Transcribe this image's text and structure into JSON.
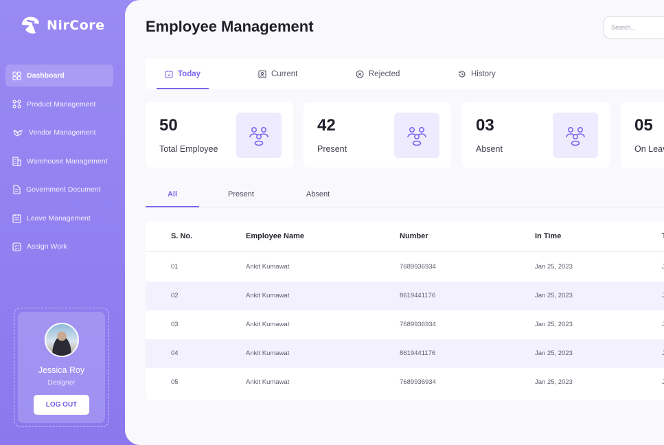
{
  "brand": {
    "name": "NirCore"
  },
  "sidebar": {
    "items": [
      {
        "label": "Dashboard",
        "icon": "grid-icon",
        "active": true
      },
      {
        "label": "Product Management",
        "icon": "nodes-icon",
        "active": false
      },
      {
        "label": "Vendor Management",
        "icon": "handshake-icon",
        "active": false
      },
      {
        "label": "Warehouse Management",
        "icon": "building-icon",
        "active": false
      },
      {
        "label": "Government Document",
        "icon": "document-icon",
        "active": false
      },
      {
        "label": "Leave Management",
        "icon": "calendar-icon",
        "active": false
      },
      {
        "label": "Assign Work",
        "icon": "checklist-icon",
        "active": false
      }
    ]
  },
  "profile": {
    "name": "Jessica Roy",
    "role": "Designer",
    "logout_label": "LOG OUT"
  },
  "header": {
    "title": "Employee Management",
    "search_placeholder": "Search..."
  },
  "tabs": [
    {
      "label": "Today",
      "icon": "clock-badge-icon",
      "active": true
    },
    {
      "label": "Current",
      "icon": "user-badge-icon",
      "active": false
    },
    {
      "label": "Rejected",
      "icon": "x-circle-icon",
      "active": false
    },
    {
      "label": "History",
      "icon": "history-icon",
      "active": false
    }
  ],
  "stats": [
    {
      "value": "50",
      "label": "Total Employee"
    },
    {
      "value": "42",
      "label": "Present"
    },
    {
      "value": "03",
      "label": "Absent"
    },
    {
      "value": "05",
      "label": "On Leave"
    }
  ],
  "filters": [
    {
      "label": "All",
      "active": true
    },
    {
      "label": "Present",
      "active": false
    },
    {
      "label": "Absent",
      "active": false
    }
  ],
  "table": {
    "columns": [
      "S. No.",
      "Employee Name",
      "Number",
      "In Time",
      "T"
    ],
    "rows": [
      {
        "sno": "01",
        "name": "Ankit Kumawat",
        "number": "7689936934",
        "in_time": "Jan 25, 2023",
        "extra": "J"
      },
      {
        "sno": "02",
        "name": "Ankit Kumawat",
        "number": "8619441176",
        "in_time": "Jan 25, 2023",
        "extra": "J"
      },
      {
        "sno": "03",
        "name": "Ankit Kumawat",
        "number": "7689936934",
        "in_time": "Jan 25, 2023",
        "extra": "J"
      },
      {
        "sno": "04",
        "name": "Ankit Kumawat",
        "number": "8619441176",
        "in_time": "Jan 25, 2023",
        "extra": "J"
      },
      {
        "sno": "05",
        "name": "Ankit Kumawat",
        "number": "7689936934",
        "in_time": "Jan 25, 2023",
        "extra": "J"
      }
    ]
  },
  "colors": {
    "accent": "#7a66ea",
    "sidebar": "#8d7bf0",
    "row_alt": "#f3f1fe"
  }
}
